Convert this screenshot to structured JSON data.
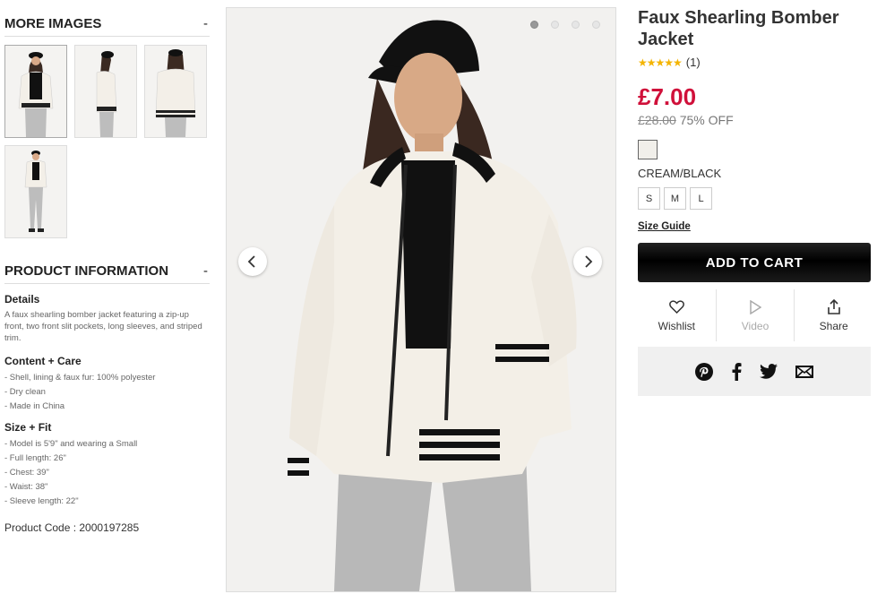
{
  "sidebar": {
    "more_images": {
      "title": "MORE IMAGES",
      "toggle": "-"
    },
    "product_info": {
      "title": "PRODUCT INFORMATION",
      "toggle": "-",
      "details_title": "Details",
      "details_text": "A faux shearling bomber jacket featuring a zip-up front, two front slit pockets, long sleeves, and striped trim.",
      "content_title": "Content + Care",
      "content_lines": [
        "- Shell, lining & faux fur: 100% polyester",
        "- Dry clean",
        "- Made in China"
      ],
      "size_title": "Size + Fit",
      "size_lines": [
        "- Model is 5'9\" and wearing a Small",
        "- Full length: 26\"",
        "- Chest: 39\"",
        "- Waist: 38\"",
        "- Sleeve length: 22\""
      ],
      "product_code": "Product Code : 2000197285"
    }
  },
  "gallery": {
    "slides": 4,
    "active_slide": 1
  },
  "product": {
    "title": "Faux Shearling Bomber Jacket",
    "rating_count": "(1)",
    "stars": "★★★★★",
    "price": "£7.00",
    "old_price": "£28.00",
    "discount": "75% OFF",
    "color_name": "CREAM/BLACK",
    "sizes": [
      "S",
      "M",
      "L"
    ],
    "size_guide": "Size Guide",
    "add_to_cart": "ADD TO CART",
    "actions": {
      "wishlist": "Wishlist",
      "video": "Video",
      "share": "Share"
    }
  },
  "colors": {
    "price": "#d0103a",
    "stars": "#f4b400",
    "swatch": "#f1efea"
  }
}
